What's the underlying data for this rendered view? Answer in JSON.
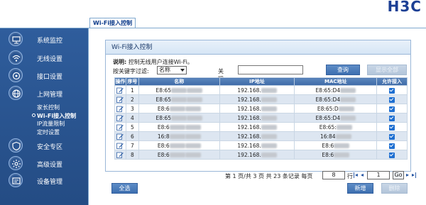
{
  "app": {
    "logo": "H3C",
    "active_tab": "Wi-Fi接入控制"
  },
  "sidebar": {
    "items": [
      {
        "label": "系统监控",
        "icon": "monitor-icon"
      },
      {
        "label": "无线设置",
        "icon": "wireless-icon"
      },
      {
        "label": "接口设置",
        "icon": "interface-icon"
      },
      {
        "label": "上网管理",
        "icon": "internet-management-icon"
      },
      {
        "label": "安全专区",
        "icon": "security-icon"
      },
      {
        "label": "高级设置",
        "icon": "advanced-icon"
      },
      {
        "label": "设备管理",
        "icon": "device-icon"
      }
    ],
    "subitems": [
      {
        "label": "家长控制"
      },
      {
        "label": "Wi-Fi接入控制",
        "active": true
      },
      {
        "label": "IP流量限制"
      },
      {
        "label": "定时设置"
      }
    ]
  },
  "panel": {
    "title": "Wi-Fi接入控制",
    "note_label": "说明:",
    "note_text": "控制无线用户连接Wi-Fi。",
    "filter_label": "按关键字过滤:",
    "filter_select": "名称",
    "keyword_label": "关键字:",
    "keyword_value": "",
    "search_button": "查询",
    "show_all_button": "显示全部"
  },
  "table": {
    "headers": [
      "操作",
      "序号",
      "名称",
      "IP地址",
      "MAC地址",
      "允许接入"
    ],
    "rows": [
      {
        "index": "1",
        "name": "E8:65",
        "ip": "192.168.",
        "mac": "E8:65:D4",
        "allowed": true
      },
      {
        "index": "2",
        "name": "E8:65",
        "ip": "192.168.",
        "mac": "E8:65:D4",
        "allowed": true
      },
      {
        "index": "3",
        "name": "E8:6",
        "ip": "192.168.",
        "mac": "E8:65:D",
        "allowed": true
      },
      {
        "index": "4",
        "name": "E8:65",
        "ip": "192.168.",
        "mac": "E8:65:D4",
        "allowed": true
      },
      {
        "index": "5",
        "name": "E8:6",
        "ip": "192.168.",
        "mac": "E8:65:",
        "allowed": true
      },
      {
        "index": "6",
        "name": "16:8",
        "ip": "192.168.",
        "mac": "16:84",
        "allowed": true
      },
      {
        "index": "7",
        "name": "E8:6",
        "ip": "192.168.",
        "mac": "E8:6",
        "allowed": true
      },
      {
        "index": "8",
        "name": "E8:6",
        "ip": "192.168.",
        "mac": "E8:6",
        "allowed": true
      }
    ]
  },
  "pager": {
    "summary": "第 1 页/共 3 页 共 23 条记录 每页",
    "per_page": "8",
    "row_label": "行",
    "page_value": "1",
    "go_label": "Go"
  },
  "footer": {
    "select_all": "全选",
    "add": "新增",
    "delete": "删除"
  }
}
